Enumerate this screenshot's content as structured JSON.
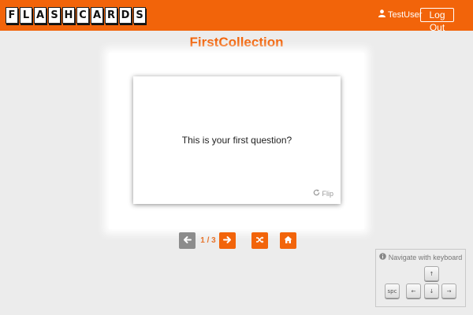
{
  "header": {
    "logo_letters": [
      "F",
      "L",
      "A",
      "S",
      "H",
      "C",
      "A",
      "R",
      "D",
      "S"
    ],
    "username": "TestUser",
    "logout_label": "Log Out",
    "icons": {
      "user": "user-icon"
    }
  },
  "collection": {
    "title": "FirstCollection"
  },
  "card": {
    "question": "This is your first question?",
    "flip_label": "Flip",
    "icons": {
      "flip": "refresh-icon"
    }
  },
  "navigation": {
    "counter": "1 / 3",
    "icons": {
      "prev": "arrow-left-icon",
      "next": "arrow-right-icon",
      "shuffle": "shuffle-icon",
      "home": "home-icon"
    }
  },
  "keyboard_help": {
    "title": "Navigate with keyboard",
    "keys": {
      "up": "↑",
      "left": "←",
      "down": "↓",
      "right": "→",
      "space": "spc"
    },
    "icons": {
      "info": "info-icon"
    }
  },
  "colors": {
    "brand": "#f2640a",
    "background": "#ececec",
    "disabled_button": "#8c8c8c"
  }
}
